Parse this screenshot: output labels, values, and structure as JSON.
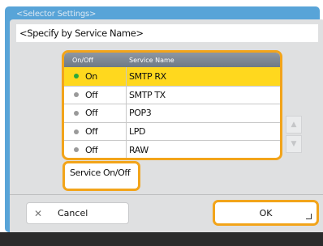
{
  "window": {
    "title": "<Selector Settings>"
  },
  "dialog": {
    "title": "<Specify by Service Name>",
    "list": {
      "headers": {
        "onoff": "On/Off",
        "name": "Service Name"
      },
      "rows": [
        {
          "state": "On",
          "name": "SMTP RX",
          "selected": true
        },
        {
          "state": "Off",
          "name": "SMTP TX",
          "selected": false
        },
        {
          "state": "Off",
          "name": "POP3",
          "selected": false
        },
        {
          "state": "Off",
          "name": "LPD",
          "selected": false
        },
        {
          "state": "Off",
          "name": "RAW",
          "selected": false
        }
      ]
    },
    "scroll": {
      "up_icon": "triangle-up-icon",
      "down_icon": "triangle-down-icon"
    },
    "service_button": "Service On/Off",
    "cancel": {
      "icon": "close-icon",
      "label": "Cancel"
    },
    "ok": {
      "label": "OK"
    }
  },
  "colors": {
    "window_blue": "#58a4d8",
    "dialog_gray": "#dfe0e1",
    "highlight_orange": "#f2a41a",
    "selected_row": "#ffd81e",
    "on_indicator": "#2aa83b",
    "off_indicator": "#9a9a9a"
  }
}
